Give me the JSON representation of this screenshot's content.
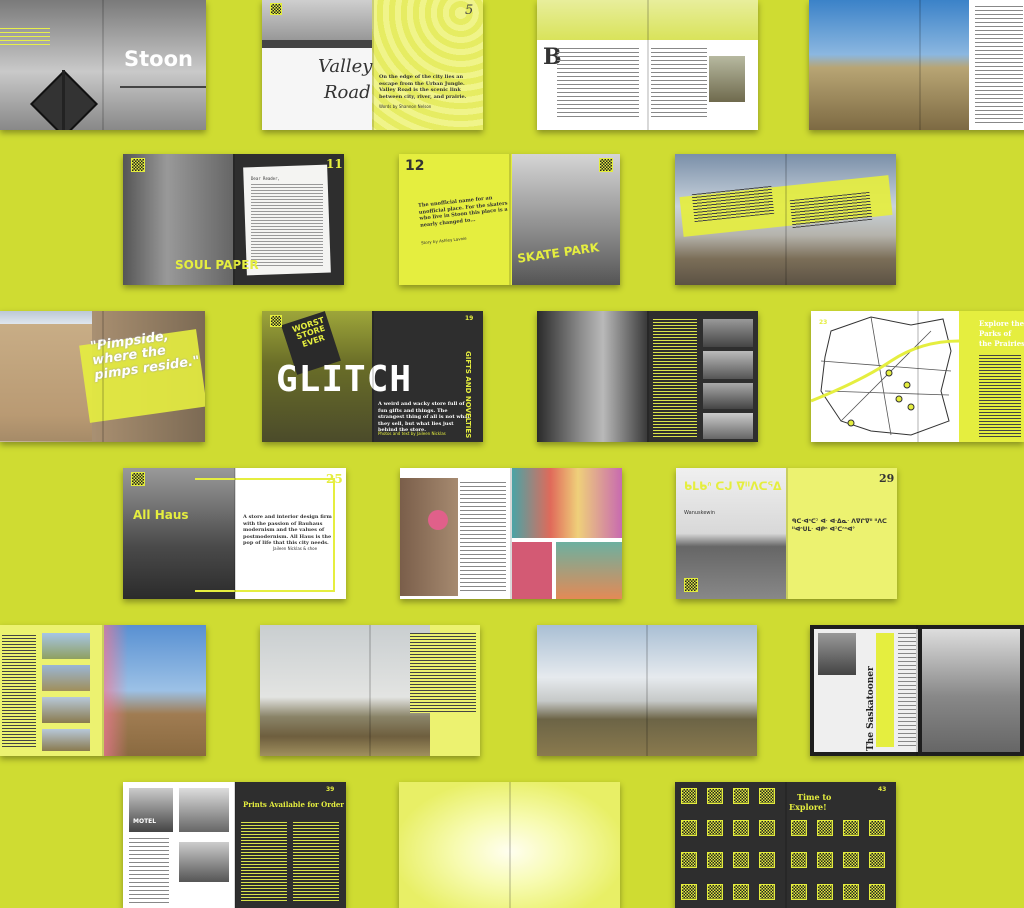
{
  "colors": {
    "background": "#cfdc32",
    "accent": "#e5ee3f",
    "dark": "#333333"
  },
  "spreads": {
    "s1": {
      "title": "Stoon"
    },
    "s2": {
      "page": "5",
      "title_line1": "Valley",
      "title_line2": "Road",
      "body": "On the edge of the city lies an escape from the Urban Jungle. Valley Road is the scenic link between city, river, and prairie.",
      "credit": "Words by Shannon Nelson"
    },
    "s3": {
      "dropcap": "B"
    },
    "s5": {
      "page": "11",
      "stamp": "SOUL PAPER",
      "letter_greeting": "Dear Reader,"
    },
    "s6": {
      "page": "12",
      "quote": "The unofficial name for an unofficial place. For the skaters who live in Stoon this place is a nearly changed to...",
      "credit": "Story by Ashley Lavoie",
      "label": "SKATE PARK"
    },
    "s8": {
      "quote": "\"Pimpside, where the pimps reside.\""
    },
    "s9": {
      "page": "19",
      "title": "GLITCH",
      "subtitle": "GIFTS AND NOVELTIES",
      "body": "A weird and wacky store full of fun gifts and things. The strangest thing of all is not what they sell, but what lies just behind the store.",
      "sign": "WORST STORE EVER",
      "credit": "Photos and text by Jaileen Nicklas"
    },
    "s11": {
      "page": "23",
      "title_line1": "Explore the",
      "title_line2": "Parks of",
      "title_line3": "the Prairies"
    },
    "s12": {
      "page": "25",
      "title": "All Haus",
      "body": "A store and interior design firm with the passion of Bauhaus modernism and the values of postmodernism. All Haus is the pop of life that this city needs.",
      "credit": "Jaileen Nicklas & shoe"
    },
    "s14": {
      "page": "29",
      "syllabics": "ᑲᒪᑲᐢ ᑕᒍ ᐁᐦᐱᑕᕐᐃ",
      "caption": "Wanuskewin",
      "body": "ᑫᑕᐧᐊᐢᑕᐣ ᐊᐧ ᐊᐧᐃᓇᐧ ᐱᐁᒋᐁᐦ ᐦᐱᑕ ᐦᐊᐢᑌᒪᐧ ᐊᑭᐢ ᐊᐣᑕᐢᐢᐊᐤ"
    },
    "s19": {
      "masthead": "The Saskatooner"
    },
    "s20": {
      "page": "39",
      "title": "Prints Available for Order",
      "sign": "MOTEL"
    },
    "s22": {
      "page": "43",
      "title_line1": "Time to",
      "title_line2": "Explore!"
    }
  }
}
